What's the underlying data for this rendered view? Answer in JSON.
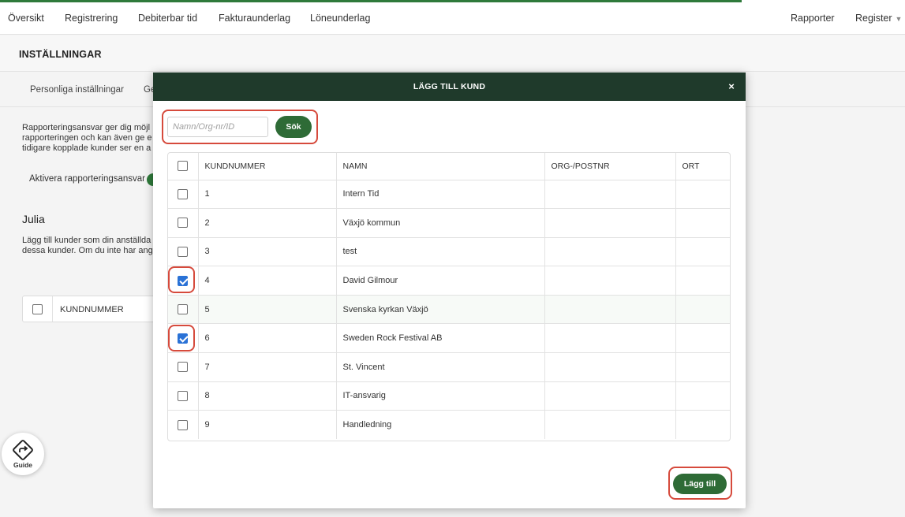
{
  "nav": {
    "left_items": [
      "Översikt",
      "Registrering",
      "Debiterbar tid",
      "Fakturaunderlag",
      "Löneunderlag"
    ],
    "right_items": [
      "Rapporter",
      "Register"
    ],
    "accent_color": "#2f7a3b"
  },
  "page": {
    "title": "INSTÄLLNINGAR",
    "sub_tabs": [
      "Personliga inställningar",
      "Ge"
    ],
    "intro_lines": [
      "Rapporteringsansvar ger dig möjl",
      "rapporteringen och kan även ge e",
      "tidigare kopplade kunder ser en a"
    ],
    "toggle_label": "Aktivera rapporteringsansvar",
    "employee_name": "Julia",
    "employee_lines": [
      "Lägg till kunder som din anställda",
      "dessa kunder. Om du inte har ang"
    ],
    "bg_table_header": "KUNDNUMMER"
  },
  "guide": {
    "label": "Guide",
    "icon": "direction-sign-icon"
  },
  "modal": {
    "title": "LÄGG TILL KUND",
    "close_label": "×",
    "header_color": "#1f3a2b",
    "search": {
      "placeholder": "Namn/Org-nr/ID",
      "value": "",
      "button_label": "Sök"
    },
    "columns": [
      "KUNDNUMMER",
      "NAMN",
      "ORG-/POSTNR",
      "ORT"
    ],
    "rows": [
      {
        "number": "1",
        "name": "Intern Tid",
        "org": "",
        "city": "",
        "checked": false
      },
      {
        "number": "2",
        "name": "Växjö kommun",
        "org": "",
        "city": "",
        "checked": false
      },
      {
        "number": "3",
        "name": "test",
        "org": "",
        "city": "",
        "checked": false
      },
      {
        "number": "4",
        "name": "David Gilmour",
        "org": "",
        "city": "",
        "checked": true
      },
      {
        "number": "5",
        "name": "Svenska kyrkan Växjö",
        "org": "",
        "city": "",
        "checked": false
      },
      {
        "number": "6",
        "name": "Sweden Rock Festival AB",
        "org": "",
        "city": "",
        "checked": true
      },
      {
        "number": "7",
        "name": "St. Vincent",
        "org": "",
        "city": "",
        "checked": false
      },
      {
        "number": "8",
        "name": "IT-ansvarig",
        "org": "",
        "city": "",
        "checked": false
      },
      {
        "number": "9",
        "name": "Handledning",
        "org": "",
        "city": "",
        "checked": false
      }
    ],
    "add_button_label": "Lägg till",
    "button_color": "#2e6b36",
    "highlight_color": "#d64a3c"
  }
}
